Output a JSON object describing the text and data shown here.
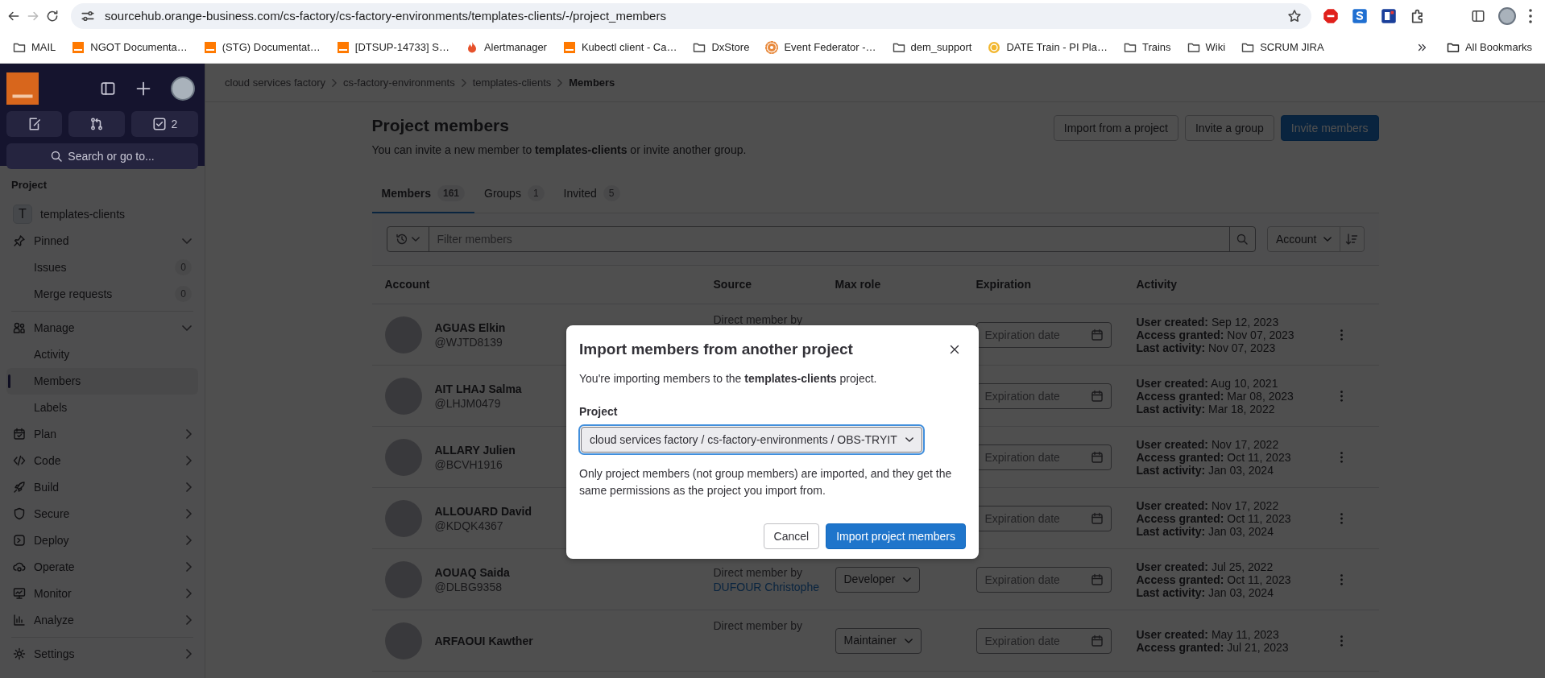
{
  "browser": {
    "url": "sourcehub.orange-business.com/cs-factory/cs-factory-environments/templates-clients/-/project_members",
    "can_go_forward": false,
    "bookmarks": [
      {
        "label": "MAIL",
        "kind": "folder"
      },
      {
        "label": "NGOT Documenta…",
        "kind": "orange"
      },
      {
        "label": "(STG) Documentat…",
        "kind": "orange"
      },
      {
        "label": "[DTSUP-14733] S…",
        "kind": "orange"
      },
      {
        "label": "Alertmanager",
        "kind": "flame"
      },
      {
        "label": "Kubectl client - Ca…",
        "kind": "orange"
      },
      {
        "label": "DxStore",
        "kind": "folder"
      },
      {
        "label": "Event Federator -…",
        "kind": "gear"
      },
      {
        "label": "dem_support",
        "kind": "folder"
      },
      {
        "label": "DATE Train - PI Pla…",
        "kind": "coin"
      },
      {
        "label": "Trains",
        "kind": "folder"
      },
      {
        "label": "Wiki",
        "kind": "folder"
      },
      {
        "label": "SCRUM JIRA",
        "kind": "folder"
      }
    ],
    "all_bookmarks": "All Bookmarks"
  },
  "sidebar": {
    "todo_count": "2",
    "search": "Search or go to...",
    "context": "Project",
    "project": {
      "letter": "T",
      "name": "templates-clients"
    },
    "groups": [
      [
        {
          "label": "Pinned",
          "expanded": true,
          "children": [
            {
              "label": "Issues",
              "count": "0",
              "selected": false
            },
            {
              "label": "Merge requests",
              "count": "0",
              "selected": false
            }
          ]
        }
      ],
      [
        {
          "label": "Manage",
          "expanded": true,
          "children": [
            {
              "label": "Activity",
              "selected": false
            },
            {
              "label": "Members",
              "selected": true
            },
            {
              "label": "Labels",
              "selected": false
            }
          ]
        },
        {
          "label": "Plan",
          "expanded": false
        },
        {
          "label": "Code",
          "expanded": false
        },
        {
          "label": "Build",
          "expanded": false
        },
        {
          "label": "Secure",
          "expanded": false
        },
        {
          "label": "Deploy",
          "expanded": false
        },
        {
          "label": "Operate",
          "expanded": false
        },
        {
          "label": "Monitor",
          "expanded": false
        },
        {
          "label": "Analyze",
          "expanded": false
        }
      ],
      [
        {
          "label": "Settings",
          "expanded": false
        }
      ]
    ]
  },
  "breadcrumb": [
    "cloud services factory",
    "cs-factory-environments",
    "templates-clients",
    "Members"
  ],
  "header": {
    "title": "Project members",
    "subtitle": "You can invite a new member to **templates-clients** or invite another group.",
    "buttons": [
      {
        "label": "Import from a project",
        "kind": "default"
      },
      {
        "label": "Invite a group",
        "kind": "default"
      },
      {
        "label": "Invite members",
        "kind": "primary"
      }
    ]
  },
  "tabs": [
    {
      "label": "Members",
      "count": "161",
      "selected": true
    },
    {
      "label": "Groups",
      "count": "1",
      "selected": false
    },
    {
      "label": "Invited",
      "count": "5",
      "selected": false
    }
  ],
  "filter": {
    "placeholder": "Filter members",
    "sort": "Account"
  },
  "table": {
    "columns": [
      "Account",
      "Source",
      "Max role",
      "Expiration",
      "Activity"
    ],
    "rows": [
      {
        "name": "AGUAS Elkin",
        "username": "@WJTD8139",
        "source": "Direct member by",
        "expiration_placeholder": "Expiration date",
        "activity": [
          "**User created:** Sep 12, 2023",
          "**Access granted:** Nov 07, 2023",
          "**Last activity:** Nov 07, 2023"
        ]
      },
      {
        "name": "AIT LHAJ Salma",
        "username": "@LHJM0479",
        "expiration_placeholder": "Expiration date",
        "activity": [
          "**User created:** Aug 10, 2021",
          "**Access granted:** Mar 08, 2023",
          "**Last activity:** Mar 18, 2022"
        ]
      },
      {
        "name": "ALLARY Julien",
        "username": "@BCVH1916",
        "expiration_placeholder": "Expiration date",
        "activity": [
          "**User created:** Nov 17, 2022",
          "**Access granted:** Oct 11, 2023",
          "**Last activity:** Jan 03, 2024"
        ]
      },
      {
        "name": "ALLOUARD David",
        "username": "@KDQK4367",
        "expiration_placeholder": "Expiration date",
        "activity": [
          "**User created:** Nov 17, 2022",
          "**Access granted:** Oct 11, 2023",
          "**Last activity:** Jan 03, 2024"
        ]
      },
      {
        "name": "AOUAQ Saida",
        "username": "@DLBG9358",
        "source": "Direct member by",
        "source_link": "DUFOUR Christophe",
        "max_role": "Developer",
        "expiration_placeholder": "Expiration date",
        "activity": [
          "**User created:** Jul 25, 2022",
          "**Access granted:** Oct 11, 2023",
          "**Last activity:** Jan 03, 2024"
        ]
      },
      {
        "name": "ARFAOUI Kawther",
        "source": "Direct member by",
        "max_role": "Maintainer",
        "expiration_placeholder": "Expiration date",
        "activity": [
          "**User created:** May 11, 2023",
          "**Access granted:** Jul 21, 2023"
        ]
      }
    ]
  },
  "modal": {
    "title": "Import members from another project",
    "text": "You're importing members to the **templates-clients** project.",
    "label": "Project",
    "value": "cloud services factory / cs-factory-environments / OBS-TRYIT",
    "help": "Only project members (not group members) are imported, and they get the same permissions as the project you import from.",
    "cancel": "Cancel",
    "confirm": "Import project members"
  }
}
